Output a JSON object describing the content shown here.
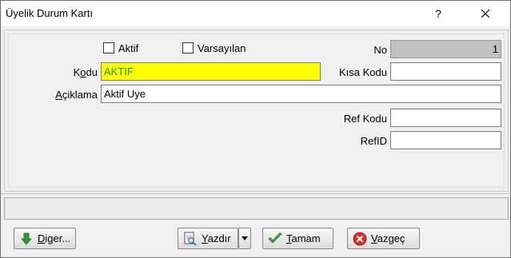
{
  "window": {
    "title": "Üyelik Durum Kartı",
    "help_glyph": "?",
    "close_icon": "close-icon"
  },
  "form": {
    "aktif": {
      "label": "Aktif",
      "checked": false
    },
    "varsayilan": {
      "label": "Varsayılan",
      "checked": false
    },
    "no": {
      "label": "No",
      "value": "1"
    },
    "kodu": {
      "label_pre": "K",
      "label_u": "o",
      "label_post": "du",
      "value": "AKTIF"
    },
    "kisa_kodu": {
      "label": "Kısa Kodu",
      "value": ""
    },
    "aciklama": {
      "label_u": "A",
      "label_post": "çiklama",
      "value": "Aktif Uye"
    },
    "ref_kodu": {
      "label": "Ref Kodu",
      "value": ""
    },
    "ref_id": {
      "label": "RefID",
      "value": ""
    }
  },
  "status_bar": {
    "text": ""
  },
  "buttons": {
    "diger": {
      "label_u": "D",
      "label_post": "iger...",
      "icon": "arrow-down-icon"
    },
    "yazdir": {
      "label_u": "Y",
      "label_post": "azdır",
      "icon": "print-preview-icon"
    },
    "tamam": {
      "label_u": "T",
      "label_post": "amam",
      "icon": "check-icon"
    },
    "vazgec": {
      "label_u": "V",
      "label_post": "azgeç",
      "icon": "cancel-icon"
    }
  },
  "colors": {
    "kodu_background": "#ffff00",
    "kodu_text": "#1a9c1a",
    "no_background": "#c0c0c0"
  }
}
